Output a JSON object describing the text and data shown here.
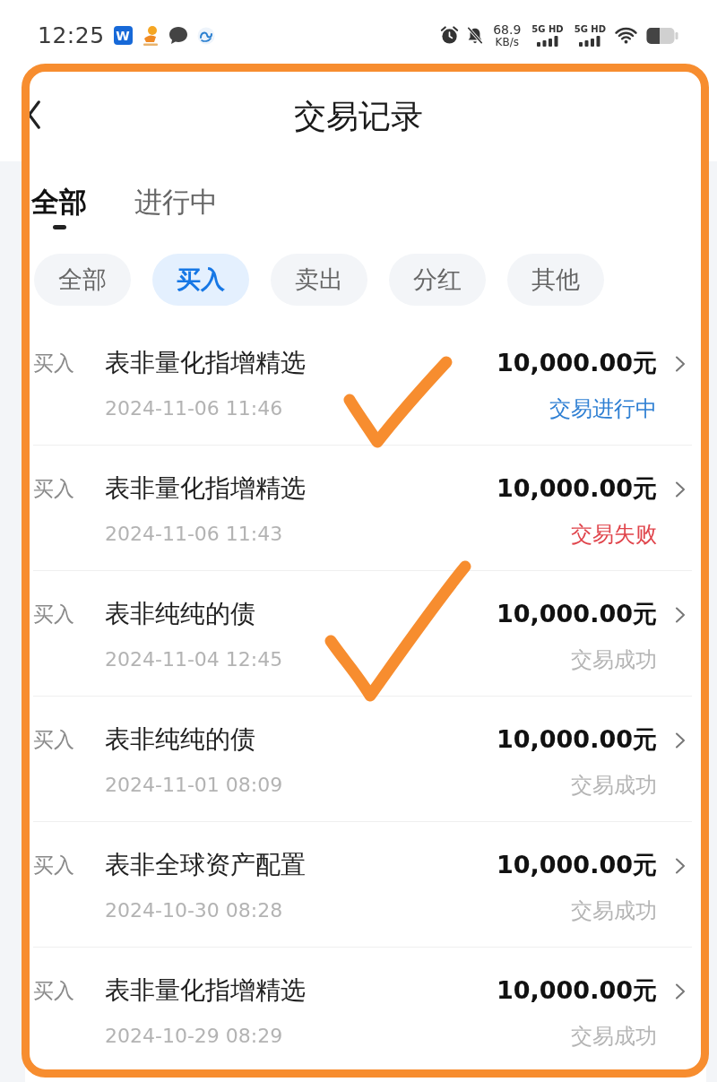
{
  "status_bar": {
    "time": "12:25",
    "app_icons": [
      {
        "kind": "letter",
        "letter": "W"
      },
      {
        "kind": "mascot"
      },
      {
        "kind": "chat"
      },
      {
        "kind": "swirl"
      }
    ],
    "net_speed": "68.9",
    "net_speed_unit": "KB/s",
    "sims": [
      {
        "label": "5G HD"
      },
      {
        "label": "5G HD"
      }
    ]
  },
  "header": {
    "title": "交易记录"
  },
  "tabs": [
    {
      "label": "全部",
      "selected": true
    },
    {
      "label": "进行中",
      "selected": false
    }
  ],
  "filters": [
    {
      "label": "全部",
      "selected": false
    },
    {
      "label": "买入",
      "selected": true
    },
    {
      "label": "卖出",
      "selected": false
    },
    {
      "label": "分红",
      "selected": false
    },
    {
      "label": "其他",
      "selected": false
    }
  ],
  "records": [
    {
      "type": "买入",
      "name": "表非量化指增精选",
      "date": "2024-11-06 11:46",
      "amount": "10,000.00元",
      "status": "交易进行中",
      "in_progress": true,
      "failed": false
    },
    {
      "type": "买入",
      "name": "表非量化指增精选",
      "date": "2024-11-06 11:43",
      "amount": "10,000.00元",
      "status": "交易失败",
      "in_progress": false,
      "failed": true
    },
    {
      "type": "买入",
      "name": "表非纯纯的债",
      "date": "2024-11-04 12:45",
      "amount": "10,000.00元",
      "status": "交易成功",
      "in_progress": false,
      "failed": false
    },
    {
      "type": "买入",
      "name": "表非纯纯的债",
      "date": "2024-11-01 08:09",
      "amount": "10,000.00元",
      "status": "交易成功",
      "in_progress": false,
      "failed": false
    },
    {
      "type": "买入",
      "name": "表非全球资产配置",
      "date": "2024-10-30 08:28",
      "amount": "10,000.00元",
      "status": "交易成功",
      "in_progress": false,
      "failed": false
    },
    {
      "type": "买入",
      "name": "表非量化指增精选",
      "date": "2024-10-29 08:29",
      "amount": "10,000.00元",
      "status": "交易成功",
      "in_progress": false,
      "failed": false
    }
  ],
  "annotations": [
    {
      "kind": "frame"
    },
    {
      "kind": "tick"
    },
    {
      "kind": "tick"
    }
  ]
}
